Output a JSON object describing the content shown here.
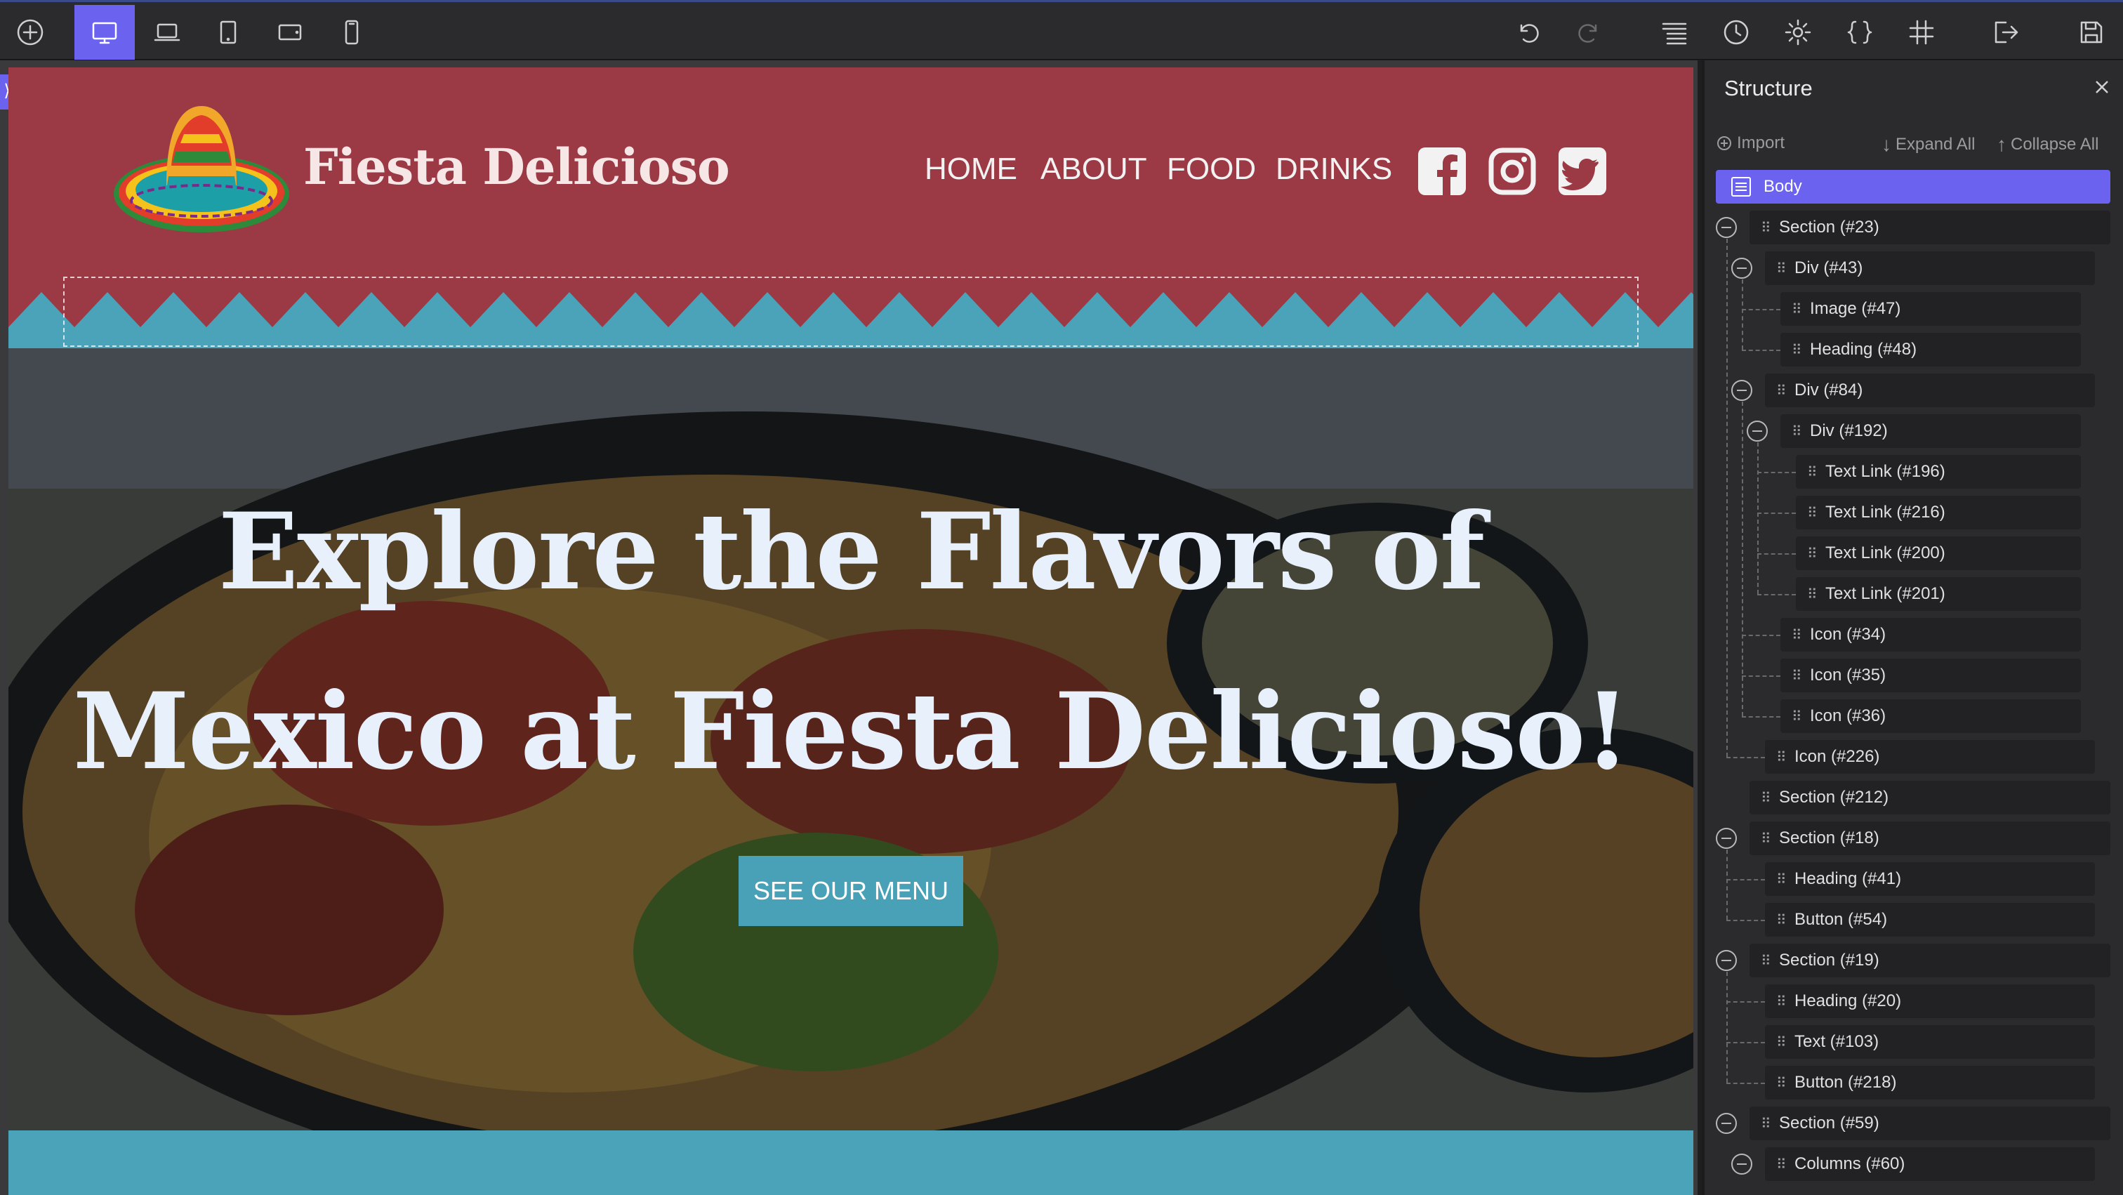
{
  "toolbar": {
    "left_icons": [
      "add-icon",
      "desktop-icon",
      "laptop-icon",
      "tablet-portrait-icon",
      "tablet-landscape-icon",
      "mobile-icon"
    ],
    "right_icons": [
      "undo-icon",
      "redo-icon",
      "layers-icon",
      "history-icon",
      "settings-icon",
      "code-icon",
      "grid-icon",
      "exit-icon",
      "save-icon"
    ]
  },
  "site": {
    "brand_name": "Fiesta Delicioso",
    "nav": [
      "HOME",
      "ABOUT",
      "FOOD",
      "DRINKS"
    ],
    "social": [
      "facebook-icon",
      "instagram-icon",
      "twitter-icon"
    ],
    "hero_line1": "Explore the Flavors of",
    "hero_line2": "Mexico at Fiesta Delicioso!",
    "cta_label": "SEE OUR MENU",
    "colors": {
      "header": "#9b3944",
      "accent": "#49a1b7",
      "hero_text": "#e8f1fb"
    }
  },
  "structure": {
    "title": "Structure",
    "import_label": "Import",
    "expand_label": "Expand All",
    "collapse_label": "Collapse All",
    "selected_color": "#6b63f0",
    "items": [
      {
        "label": "Body"
      },
      {
        "label": "Section (#23)"
      },
      {
        "label": "Div (#43)"
      },
      {
        "label": "Image (#47)"
      },
      {
        "label": "Heading (#48)"
      },
      {
        "label": "Div (#84)"
      },
      {
        "label": "Div (#192)"
      },
      {
        "label": "Text Link (#196)"
      },
      {
        "label": "Text Link (#216)"
      },
      {
        "label": "Text Link (#200)"
      },
      {
        "label": "Text Link (#201)"
      },
      {
        "label": "Icon (#34)"
      },
      {
        "label": "Icon (#35)"
      },
      {
        "label": "Icon (#36)"
      },
      {
        "label": "Icon (#226)"
      },
      {
        "label": "Section (#212)"
      },
      {
        "label": "Section (#18)"
      },
      {
        "label": "Heading (#41)"
      },
      {
        "label": "Button (#54)"
      },
      {
        "label": "Section (#19)"
      },
      {
        "label": "Heading (#20)"
      },
      {
        "label": "Text (#103)"
      },
      {
        "label": "Button (#218)"
      },
      {
        "label": "Section (#59)"
      },
      {
        "label": "Columns (#60)"
      }
    ]
  }
}
